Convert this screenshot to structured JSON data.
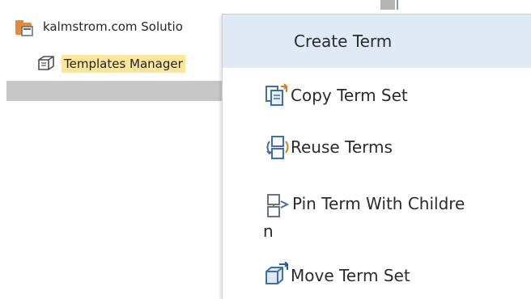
{
  "tree": {
    "root_label": "kalmstrom.com Solutio",
    "child_label": "Templates Manager"
  },
  "context_menu": {
    "items": [
      {
        "label": "Create Term",
        "icon": "none"
      },
      {
        "label": "Copy Term Set",
        "icon": "copy-term-set-icon"
      },
      {
        "label": "Reuse Terms",
        "icon": "reuse-terms-icon"
      },
      {
        "label": "Pin Term With Childre",
        "label_wrap": "n",
        "icon": "pin-term-icon"
      },
      {
        "label": "Move Term Set",
        "icon": "move-term-set-icon"
      }
    ]
  },
  "colors": {
    "selection_highlight": "#fbe69a",
    "menu_hover": "#dfeaf6",
    "selection_bar": "#c7c7c7"
  }
}
